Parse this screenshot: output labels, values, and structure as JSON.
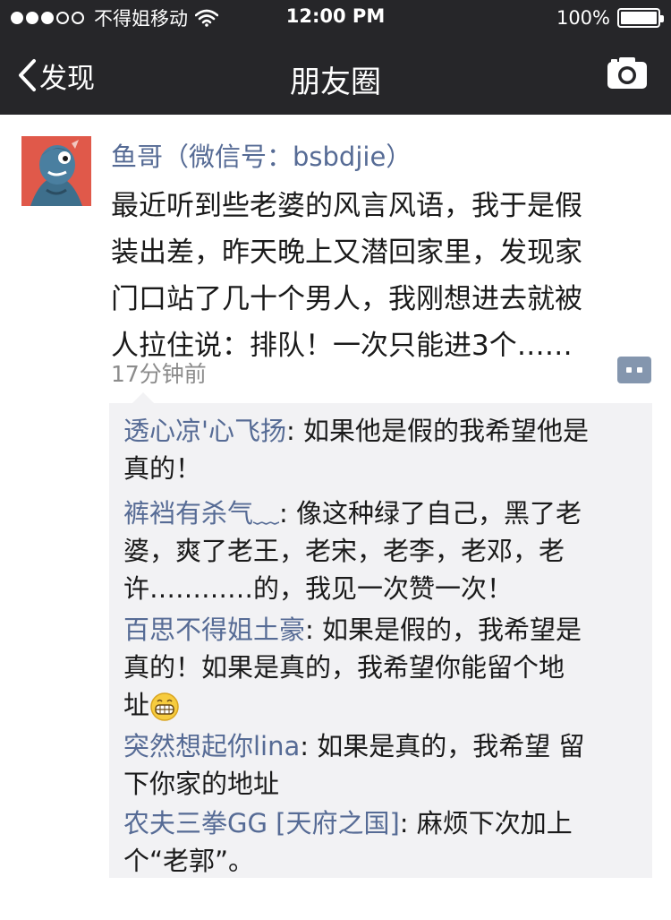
{
  "status_bar": {
    "carrier": "不得姐移动",
    "time": "12:00 PM",
    "battery": "100%",
    "signal_bars_filled": 3,
    "signal_bars_total": 5
  },
  "nav": {
    "back_label": "发现",
    "title": "朋友圈",
    "camera_icon": "camera-icon"
  },
  "post": {
    "author": "鱼哥（微信号：bsbdjie）",
    "content_lines": [
      "最近听到些老婆的风言风语，我于是假",
      "装出差，昨天晚上又潜回家里，发现家",
      "门口站了几十个男人，我刚想进去就被",
      "人拉住说：排队！一次只能进3个……"
    ],
    "time_ago": "17分钟前",
    "comments": [
      {
        "name": "透心凉'心飞扬",
        "line1": ": 如果他是假的我希望他是",
        "rest": [
          "真的！"
        ]
      },
      {
        "name": "裤裆有杀气﹏",
        "line1": ": 像这种绿了自己，黑了老",
        "rest": [
          "婆，爽了老王，老宋，老李，老邓，老",
          "许…………的，我见一次赞一次！"
        ]
      },
      {
        "name": "百思不得姐土豪",
        "line1": ": 如果是假的，我希望是",
        "rest": [
          "真的！如果是真的，我希望你能留个地",
          "址"
        ]
      },
      {
        "name": "突然想起你lina",
        "line1": ": 如果是真的，我希望  留",
        "rest": [
          "下你家的地址"
        ]
      },
      {
        "name": "农夫三拳GG [天府之国]",
        "line1": ": 麻烦下次加上",
        "rest": [
          "个“老郭”。"
        ]
      }
    ]
  },
  "colors": {
    "bar_bg": "#262629",
    "name_blue": "#566b95",
    "comment_bg": "#f2f2f4",
    "timestamp_gray": "#8c8c8c"
  }
}
